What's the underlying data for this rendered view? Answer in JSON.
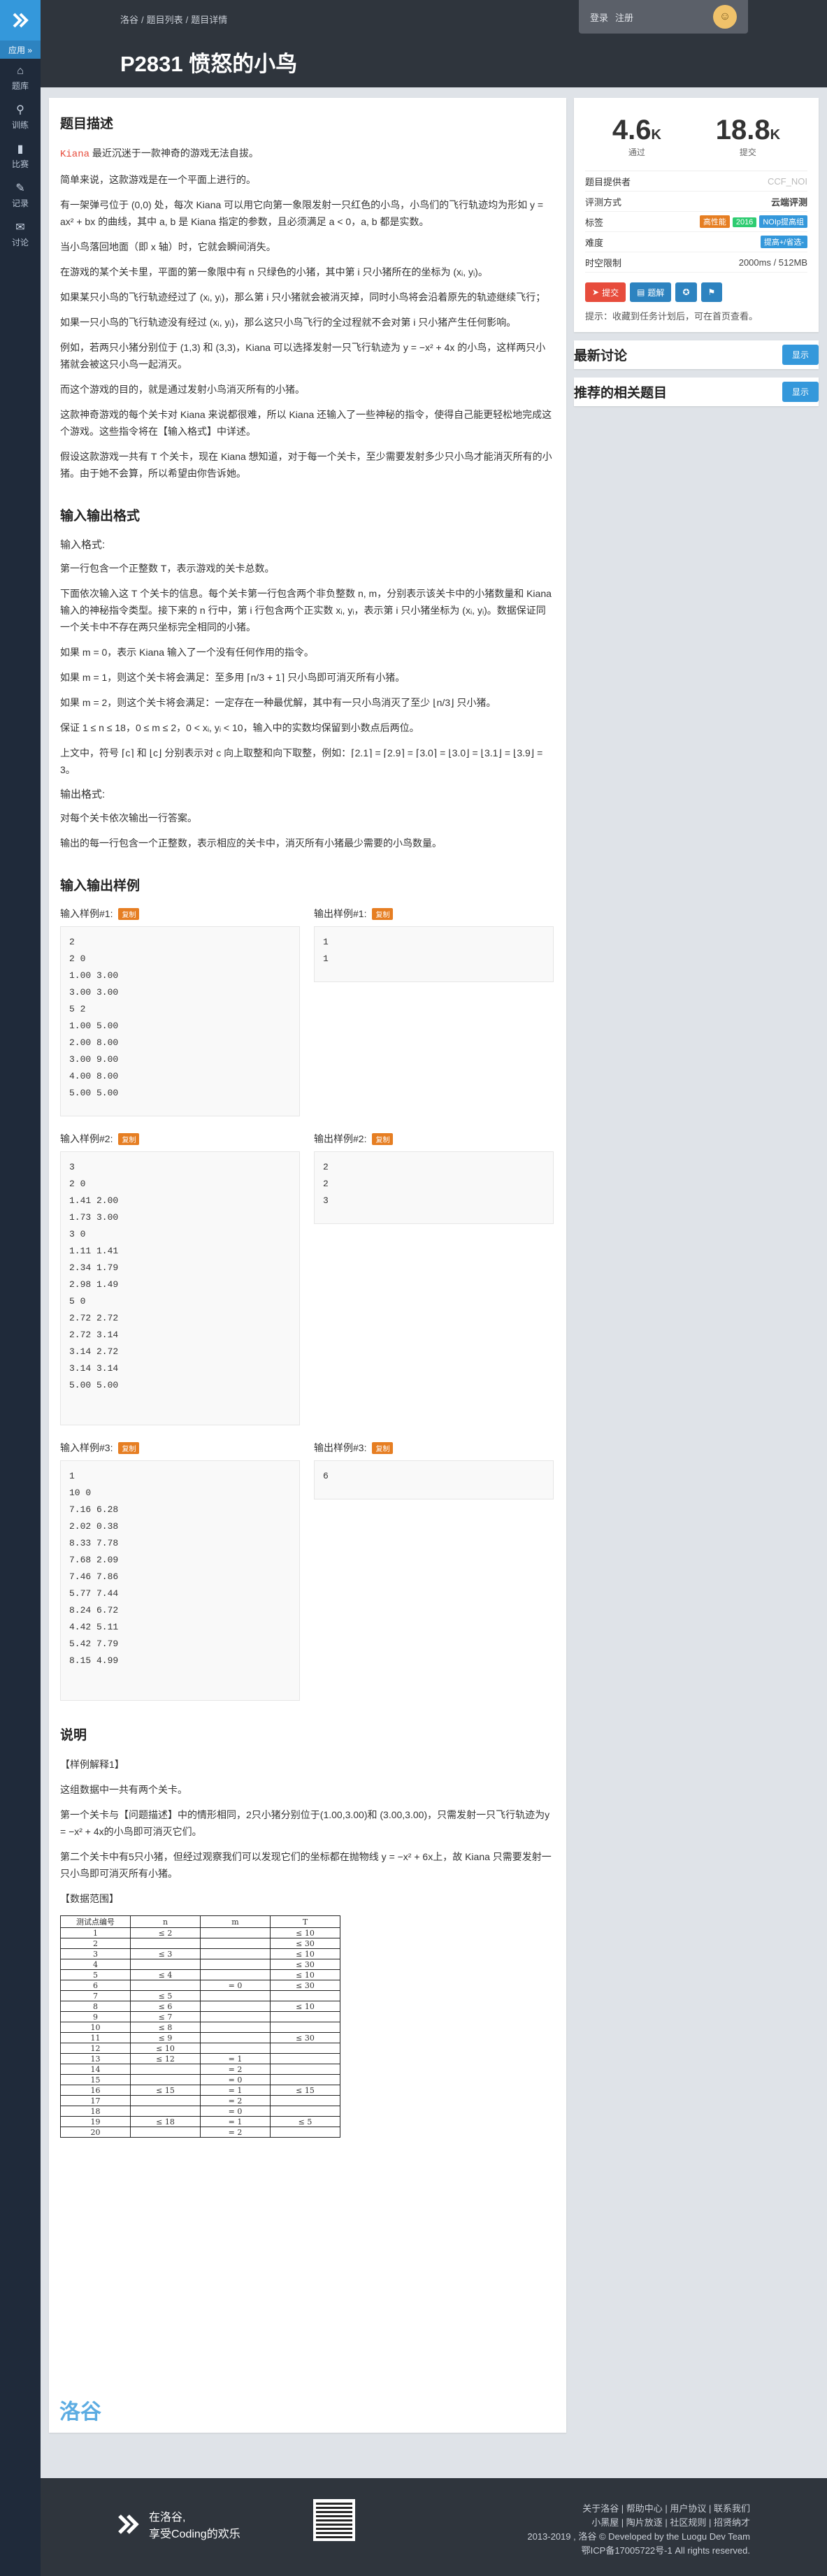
{
  "sidebar": {
    "apps_label": "应用 »",
    "items": [
      {
        "icon": "⌂",
        "label": "题库"
      },
      {
        "icon": "⚲",
        "label": "训练"
      },
      {
        "icon": "▮",
        "label": "比赛"
      },
      {
        "icon": "✎",
        "label": "记录"
      },
      {
        "icon": "✉",
        "label": "讨论"
      }
    ]
  },
  "header": {
    "breadcrumb": [
      "洛谷",
      "/",
      "题目列表",
      "/",
      "题目详情"
    ],
    "title": "P2831 愤怒的小鸟",
    "login": "登录",
    "register": "注册"
  },
  "description": {
    "heading": "题目描述",
    "paras": [
      [
        "Kiana",
        "最近沉迷于一款神奇的游戏无法自拔。"
      ],
      [
        "",
        "简单来说，这款游戏是在一个平面上进行的。"
      ],
      [
        "",
        "有一架弹弓位于 (0,0) 处，每次 Kiana 可以用它向第一象限发射一只红色的小鸟，小鸟们的飞行轨迹均为形如 y = ax² + bx 的曲线，其中 a, b 是 Kiana 指定的参数，且必须满足 a < 0，a, b 都是实数。"
      ],
      [
        "",
        "当小鸟落回地面（即 x 轴）时，它就会瞬间消失。"
      ],
      [
        "",
        "在游戏的某个关卡里，平面的第一象限中有 n 只绿色的小猪，其中第 i 只小猪所在的坐标为 (xᵢ, yᵢ)。"
      ],
      [
        "",
        "如果某只小鸟的飞行轨迹经过了 (xᵢ, yᵢ)，那么第 i 只小猪就会被消灭掉，同时小鸟将会沿着原先的轨迹继续飞行；"
      ],
      [
        "",
        "如果一只小鸟的飞行轨迹没有经过 (xᵢ, yᵢ)，那么这只小鸟飞行的全过程就不会对第 i 只小猪产生任何影响。"
      ],
      [
        "",
        "例如，若两只小猪分别位于 (1,3) 和 (3,3)，Kiana 可以选择发射一只飞行轨迹为 y = −x² + 4x 的小鸟，这样两只小猪就会被这只小鸟一起消灭。"
      ],
      [
        "",
        "而这个游戏的目的，就是通过发射小鸟消灭所有的小猪。"
      ],
      [
        "",
        "这款神奇游戏的每个关卡对 Kiana 来说都很难，所以 Kiana 还输入了一些神秘的指令，使得自己能更轻松地完成这个游戏。这些指令将在【输入格式】中详述。"
      ],
      [
        "",
        "假设这款游戏一共有 T 个关卡，现在 Kiana 想知道，对于每一个关卡，至少需要发射多少只小鸟才能消灭所有的小猪。由于她不会算，所以希望由你告诉她。"
      ]
    ]
  },
  "io": {
    "heading": "输入输出格式",
    "input_label": "输入格式:",
    "output_label": "输出格式:",
    "input_paras": [
      "第一行包含一个正整数 T，表示游戏的关卡总数。",
      "下面依次输入这 T 个关卡的信息。每个关卡第一行包含两个非负整数 n, m，分别表示该关卡中的小猪数量和 Kiana 输入的神秘指令类型。接下来的 n 行中，第 i 行包含两个正实数 xᵢ, yᵢ，表示第 i 只小猪坐标为 (xᵢ, yᵢ)。数据保证同一个关卡中不存在两只坐标完全相同的小猪。",
      "如果 m = 0，表示 Kiana 输入了一个没有任何作用的指令。",
      "如果 m = 1，则这个关卡将会满足：至多用 ⌈n/3 + 1⌉ 只小鸟即可消灭所有小猪。",
      "如果 m = 2，则这个关卡将会满足：一定存在一种最优解，其中有一只小鸟消灭了至少 ⌊n/3⌋ 只小猪。",
      "保证 1 ≤ n ≤ 18，0 ≤ m ≤ 2，0 < xᵢ, yᵢ < 10，输入中的实数均保留到小数点后两位。",
      "上文中，符号 ⌈c⌉ 和 ⌊c⌋ 分别表示对 c 向上取整和向下取整，例如：⌈2.1⌉ = ⌈2.9⌉ = ⌈3.0⌉ = ⌊3.0⌋ = ⌊3.1⌋ = ⌊3.9⌋ = 3。"
    ],
    "output_paras": [
      "对每个关卡依次输出一行答案。",
      "输出的每一行包含一个正整数，表示相应的关卡中，消灭所有小猪最少需要的小鸟数量。"
    ]
  },
  "samples": {
    "heading": "输入输出样例",
    "copy": "复制",
    "items": [
      {
        "in_label": "输入样例#1:",
        "out_label": "输出样例#1:",
        "in": "2\n2 0\n1.00 3.00\n3.00 3.00\n5 2\n1.00 5.00\n2.00 8.00\n3.00 9.00\n4.00 8.00\n5.00 5.00",
        "out": "1\n1"
      },
      {
        "in_label": "输入样例#2:",
        "out_label": "输出样例#2:",
        "in": "3\n2 0\n1.41 2.00\n1.73 3.00\n3 0\n1.11 1.41\n2.34 1.79\n2.98 1.49\n5 0\n2.72 2.72\n2.72 3.14\n3.14 2.72\n3.14 3.14\n5.00 5.00",
        "out": "2\n2\n3"
      },
      {
        "in_label": "输入样例#3:",
        "out_label": "输出样例#3:",
        "in": "1\n10 0\n7.16 6.28\n2.02 0.38\n8.33 7.78\n7.68 2.09\n7.46 7.86\n5.77 7.44\n8.24 6.72\n4.42 5.11\n5.42 7.79\n8.15 4.99",
        "out": "6"
      }
    ]
  },
  "notes": {
    "heading": "说明",
    "sample_explain": "【样例解释1】",
    "paras": [
      "这组数据中一共有两个关卡。",
      "第一个关卡与【问题描述】中的情形相同，2只小猪分别位于(1.00,3.00)和 (3.00,3.00)，只需发射一只飞行轨迹为y = −x² + 4x的小鸟即可消灭它们。",
      "第二个关卡中有5只小猪，但经过观察我们可以发现它们的坐标都在抛物线 y = −x² + 6x上，故 Kiana 只需要发射一只小鸟即可消灭所有小猪。"
    ],
    "range_label": "【数据范围】",
    "table": {
      "headers": [
        "测试点编号",
        "n",
        "m",
        "T"
      ],
      "rows": [
        [
          "1",
          "≤ 2",
          "",
          "≤ 10"
        ],
        [
          "2",
          "",
          "",
          "≤ 30"
        ],
        [
          "3",
          "≤ 3",
          "",
          "≤ 10"
        ],
        [
          "4",
          "",
          "",
          "≤ 30"
        ],
        [
          "5",
          "≤ 4",
          "",
          "≤ 10"
        ],
        [
          "6",
          "",
          "= 0",
          "≤ 30"
        ],
        [
          "7",
          "≤ 5",
          "",
          ""
        ],
        [
          "8",
          "≤ 6",
          "",
          "≤ 10"
        ],
        [
          "9",
          "≤ 7",
          "",
          ""
        ],
        [
          "10",
          "≤ 8",
          "",
          ""
        ],
        [
          "11",
          "≤ 9",
          "",
          "≤ 30"
        ],
        [
          "12",
          "≤ 10",
          "",
          ""
        ],
        [
          "13",
          "≤ 12",
          "= 1",
          ""
        ],
        [
          "14",
          "",
          "= 2",
          ""
        ],
        [
          "15",
          "",
          "= 0",
          ""
        ],
        [
          "16",
          "≤ 15",
          "= 1",
          "≤ 15"
        ],
        [
          "17",
          "",
          "= 2",
          ""
        ],
        [
          "18",
          "",
          "= 0",
          ""
        ],
        [
          "19",
          "≤ 18",
          "= 1",
          "≤ 5"
        ],
        [
          "20",
          "",
          "= 2",
          ""
        ]
      ]
    }
  },
  "info": {
    "passed": "4.6",
    "passed_unit": "K",
    "passed_label": "通过",
    "submit": "18.8",
    "submit_unit": "K",
    "submit_label": "提交",
    "provider_label": "题目提供者",
    "provider": "CCF_NOI",
    "judge_label": "评测方式",
    "judge": "云端评测",
    "tags_label": "标签",
    "tags": [
      {
        "t": "高性能",
        "c": "#e67e22"
      },
      {
        "t": "2016",
        "c": "#2ecc71"
      },
      {
        "t": "NOIp提高组",
        "c": "#3498db"
      }
    ],
    "difficulty_label": "难度",
    "difficulty": "提高+/省选-",
    "difficulty_color": "#3498db",
    "limit_label": "时空限制",
    "limit": "2000ms / 512MB",
    "btn_submit": "提交",
    "btn_solution": "题解",
    "hint": "提示：收藏到任务计划后，可在首页查看。"
  },
  "discuss": {
    "title": "最新讨论",
    "show": "显示"
  },
  "recommend": {
    "title": "推荐的相关题目",
    "show": "显示"
  },
  "watermark": "洛谷",
  "footer": {
    "slogan1": "在洛谷,",
    "slogan2": "享受Coding的欢乐",
    "links": [
      "关于洛谷 | 帮助中心 | 用户协议 | 联系我们",
      "小黑屋 | 陶片放逐 | 社区规则 | 招贤纳才",
      "2013-2019 , 洛谷 © Developed by the Luogu Dev Team",
      "鄂ICP备17005722号-1 All rights reserved."
    ]
  }
}
